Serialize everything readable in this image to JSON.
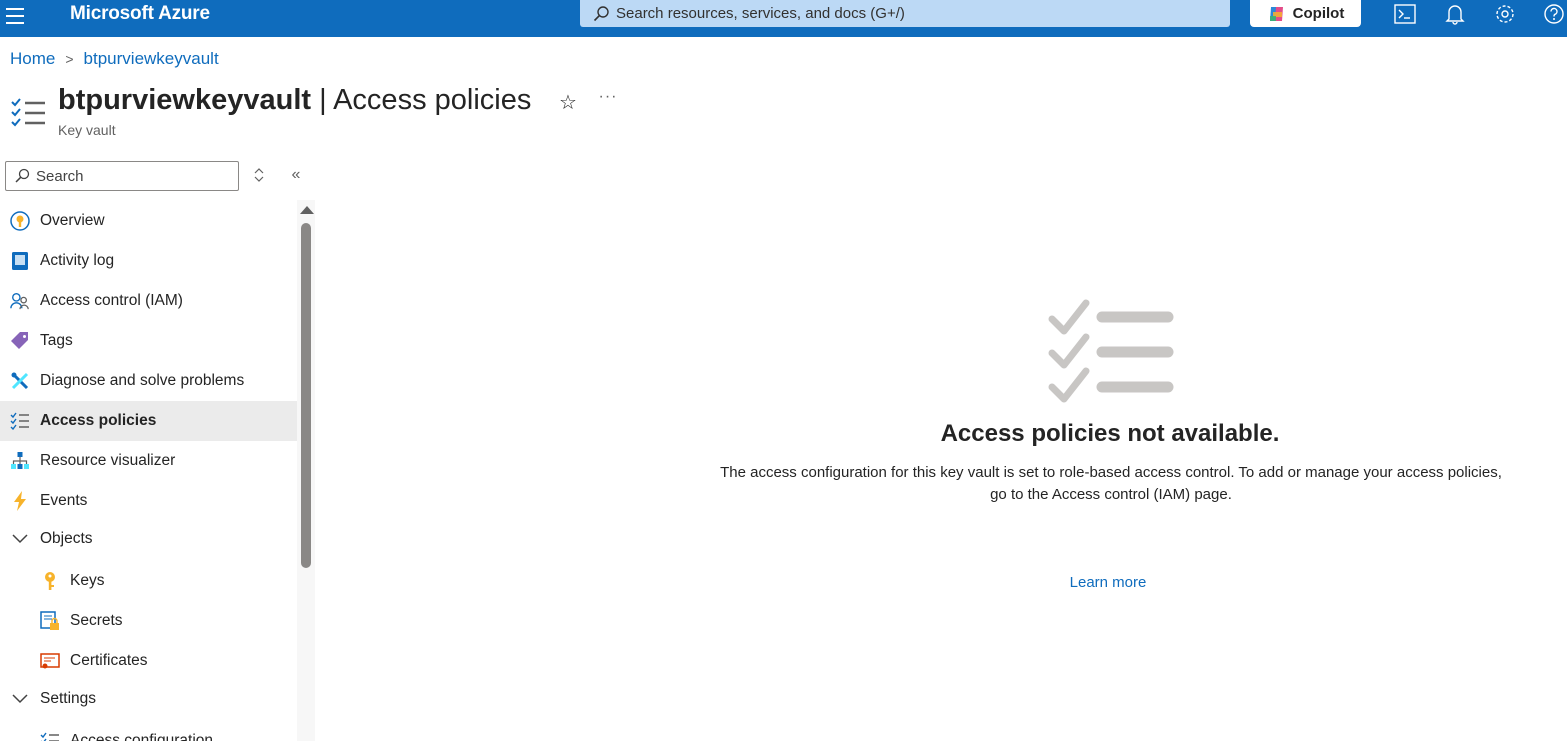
{
  "topbar": {
    "brand": "Microsoft Azure",
    "search_placeholder": "Search resources, services, and docs (G+/)",
    "copilot_label": "Copilot",
    "icons": [
      "menu-icon",
      "cloud-shell-icon",
      "notifications-icon",
      "settings-icon",
      "help-icon"
    ],
    "bar_color": "#0f6cbd"
  },
  "breadcrumb": {
    "home": "Home",
    "separator": ">",
    "current": "btpurviewkeyvault"
  },
  "header": {
    "resource_name": "btpurviewkeyvault",
    "divider": " | ",
    "blade_name": "Access policies",
    "subtitle": "Key vault",
    "star": "☆",
    "more": "···"
  },
  "sidebar": {
    "search_placeholder": "Search",
    "updown": "⬦",
    "collapse": "«",
    "items": [
      {
        "label": "Overview",
        "icon": "overview-icon"
      },
      {
        "label": "Activity log",
        "icon": "activity-log-icon"
      },
      {
        "label": "Access control (IAM)",
        "icon": "iam-icon"
      },
      {
        "label": "Tags",
        "icon": "tag-icon"
      },
      {
        "label": "Diagnose and solve problems",
        "icon": "wrench-icon"
      },
      {
        "label": "Access policies",
        "icon": "checklist-icon",
        "selected": true
      },
      {
        "label": "Resource visualizer",
        "icon": "resource-visualizer-icon"
      },
      {
        "label": "Events",
        "icon": "lightning-icon"
      },
      {
        "label": "Objects",
        "icon": "chevron-down-icon",
        "group": true
      },
      {
        "label": "Keys",
        "icon": "key-icon",
        "sub": true
      },
      {
        "label": "Secrets",
        "icon": "secret-icon",
        "sub": true
      },
      {
        "label": "Certificates",
        "icon": "certificate-icon",
        "sub": true
      },
      {
        "label": "Settings",
        "icon": "chevron-down-icon",
        "group": true
      },
      {
        "label": "Access configuration",
        "icon": "checklist-icon",
        "sub": true
      }
    ]
  },
  "main": {
    "empty_title": "Access policies not available.",
    "empty_desc_line1": "The access configuration for this key vault is set to role-based access control. To add or manage your access policies,",
    "empty_desc_line2": "go to the Access control (IAM) page.",
    "learn_more": "Learn more"
  }
}
